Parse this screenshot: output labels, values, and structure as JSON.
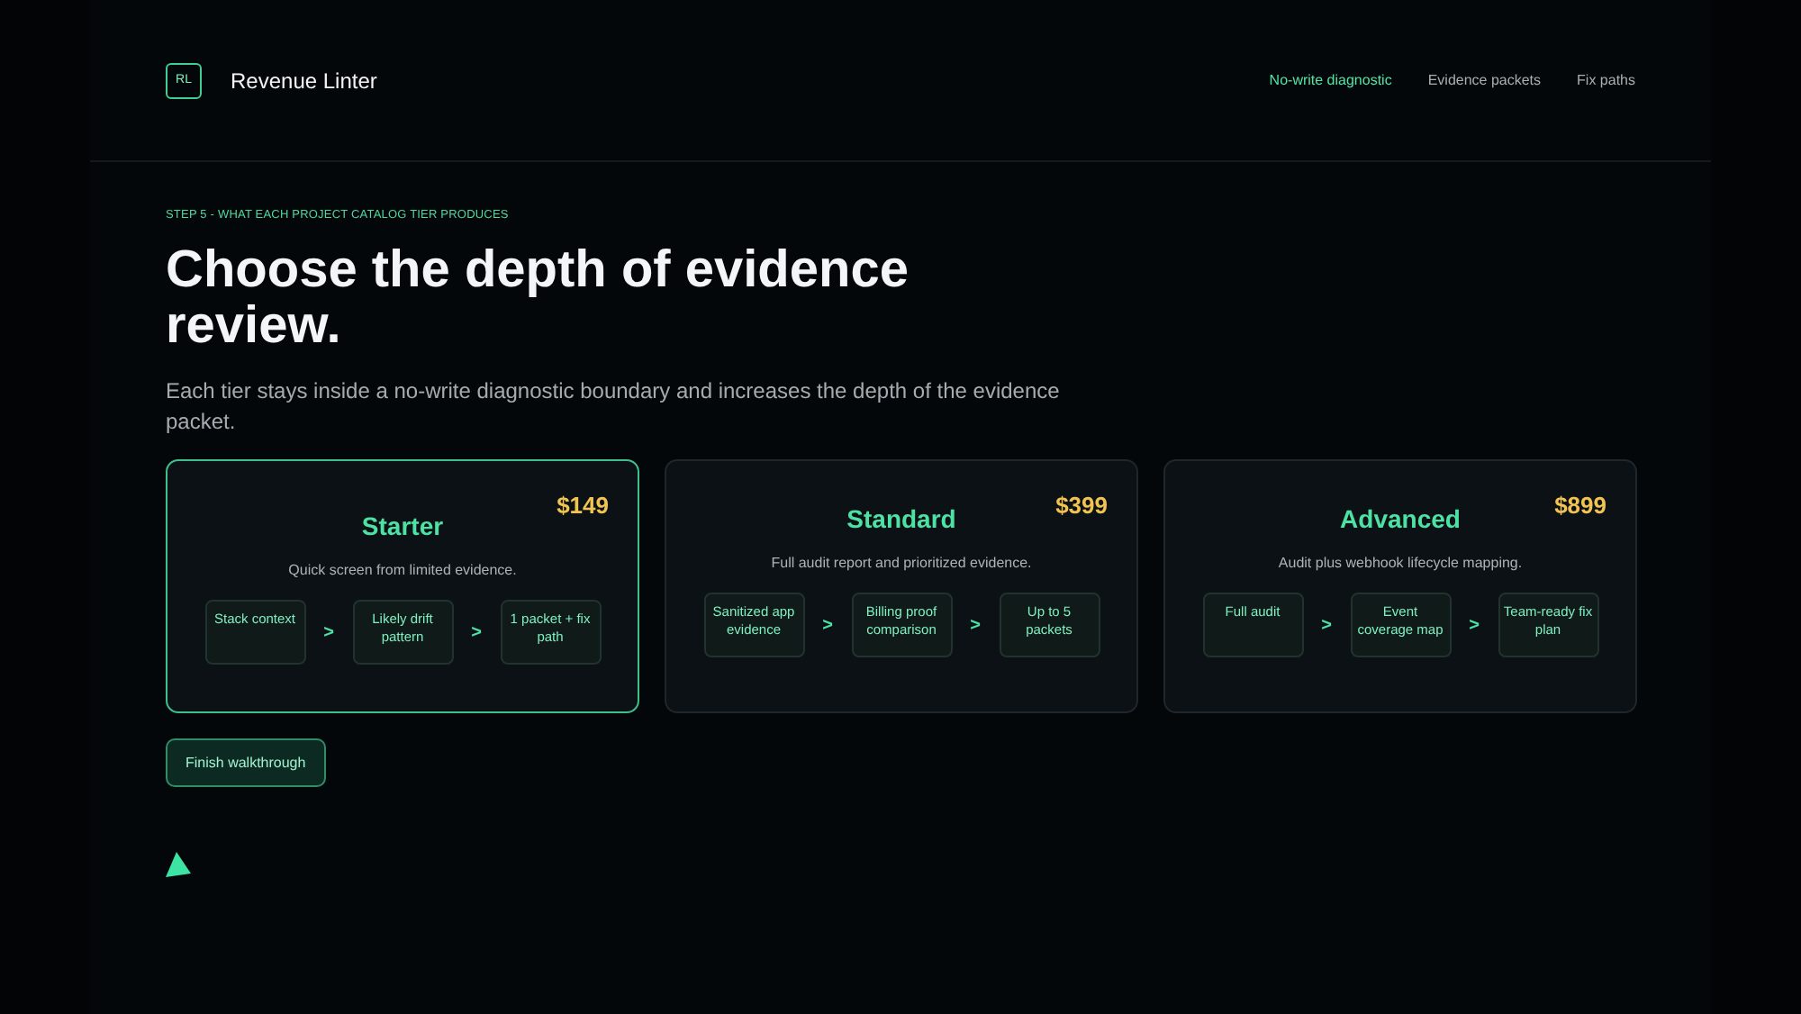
{
  "brand": {
    "logo": "RL",
    "name": "Revenue Linter"
  },
  "nav": [
    {
      "label": "No-write diagnostic",
      "selected": true
    },
    {
      "label": "Evidence packets",
      "selected": false
    },
    {
      "label": "Fix paths",
      "selected": false
    }
  ],
  "eyebrow": "STEP 5 - WHAT EACH PROJECT CATALOG TIER PRODUCES",
  "heading": "Choose the depth of evidence review.",
  "intro": "Each tier stays inside a no-write diagnostic boundary and increases the depth of the evidence packet.",
  "tiers": [
    {
      "name": "Starter",
      "price": "$149",
      "description": "Quick screen from limited evidence.",
      "selected": true,
      "steps": [
        "Stack context",
        "Likely drift pattern",
        "1 packet + fix path"
      ],
      "separators": [
        ">",
        ">"
      ]
    },
    {
      "name": "Standard",
      "price": "$399",
      "description": "Full audit report and prioritized evidence.",
      "selected": false,
      "steps": [
        "Sanitized app evidence",
        "Billing proof comparison",
        "Up to 5 packets"
      ],
      "separators": [
        ">",
        ">"
      ]
    },
    {
      "name": "Advanced",
      "price": "$899",
      "description": "Audit plus webhook lifecycle mapping.",
      "selected": false,
      "steps": [
        "Full audit",
        "Event coverage map",
        "Team-ready fix plan"
      ],
      "separators": [
        ">",
        ">"
      ]
    }
  ],
  "finish_button": "Finish walkthrough"
}
